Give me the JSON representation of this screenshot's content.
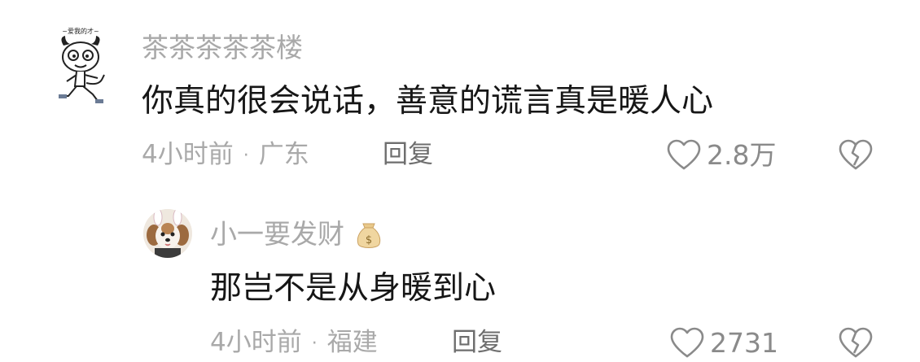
{
  "comments": [
    {
      "username": "茶茶茶茶茶楼",
      "text": "你真的很会说话，善意的谎言真是暖人心",
      "time": "4小时前",
      "location": "广东",
      "reply_label": "回复",
      "like_count": "2.8万",
      "avatar_caption": "~爱我的才~"
    },
    {
      "username": "小一要发财",
      "text": "那岂不是从身暖到心",
      "time": "4小时前",
      "location": "福建",
      "reply_label": "回复",
      "like_count": "2731"
    }
  ],
  "separator": "·",
  "colors": {
    "text_primary": "#161616",
    "text_secondary": "#a9a9a9",
    "reply_text": "#6e6e6e",
    "icon": "#8a8a8a"
  },
  "icons": {
    "like": "heart-outline-icon",
    "dislike": "broken-heart-icon",
    "badge": "money-bag-icon"
  }
}
